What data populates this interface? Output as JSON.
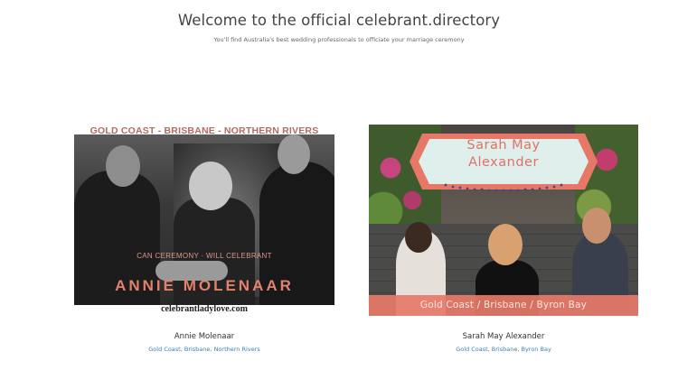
{
  "header": {
    "title": "Welcome to the official celebrant.directory",
    "subtitle": "You'll find Australia's best wedding professionals to officiate your marriage ceremony"
  },
  "celebrants": [
    {
      "name": "Annie Molenaar",
      "locations": [
        "Gold Coast",
        "Brisbane",
        "Northern Rivers"
      ],
      "image": {
        "regions_text": "GOLD COAST  -  BRISBANE  -  NORTHERN RIVERS",
        "tagline": "CAN CEREMONY · WILL CELEBRANT",
        "big_name": "ANNIE MOLENAAR",
        "website": "celebrantladylove.com"
      }
    },
    {
      "name": "Sarah May Alexander",
      "locations": [
        "Gold Coast",
        "Brisbane",
        "Byron Bay"
      ],
      "image": {
        "banner_line1": "Sarah May",
        "banner_line2": "Alexander",
        "location_strip": "Gold Coast / Brisbane / Byron Bay"
      }
    }
  ],
  "colors": {
    "link": "#3a7fb8",
    "coral": "#e77868",
    "banner_bg": "#dff0ec"
  }
}
